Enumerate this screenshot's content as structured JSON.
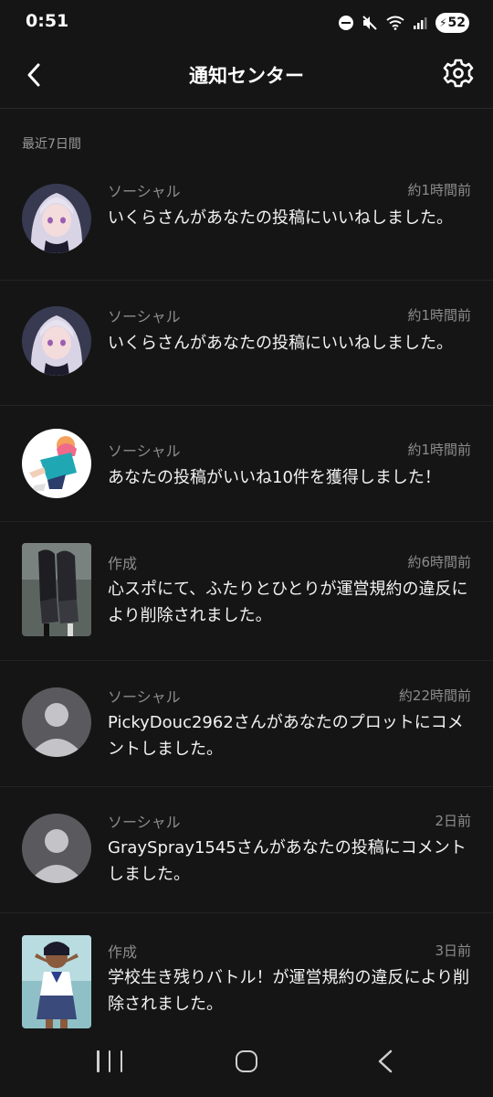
{
  "status_bar": {
    "time": "0:51",
    "battery": "52"
  },
  "header": {
    "title": "通知センター"
  },
  "section": {
    "label": "最近7日間"
  },
  "notifications": [
    {
      "category": "ソーシャル",
      "time": "約1時間前",
      "message": "いくらさんがあなたの投稿にいいねしました。",
      "avatar": "anime-girl-silver-hair"
    },
    {
      "category": "ソーシャル",
      "time": "約1時間前",
      "message": "いくらさんがあなたの投稿にいいねしました。",
      "avatar": "anime-girl-silver-hair"
    },
    {
      "category": "ソーシャル",
      "time": "約1時間前",
      "message": "あなたの投稿がいいね10件を獲得しました！",
      "avatar": "anime-character-teal-jacket"
    },
    {
      "category": "作成",
      "time": "約6時間前",
      "message": "心スポにて、ふたりとひとりが運営規約の違反により削除されました。",
      "avatar": "thumbnail-two-girls-rain"
    },
    {
      "category": "ソーシャル",
      "time": "約22時間前",
      "message": "PickyDouc2962さんがあなたのプロットにコメントしました。",
      "avatar": "default-user"
    },
    {
      "category": "ソーシャル",
      "time": "2日前",
      "message": "GraySpray1545さんがあなたの投稿にコメントしました。",
      "avatar": "default-user"
    },
    {
      "category": "作成",
      "time": "3日前",
      "message": "学校生き残りバトル！が運営規約の違反により削除されました。",
      "avatar": "thumbnail-schoolgirl"
    }
  ],
  "colors": {
    "background": "#151515",
    "text_primary": "#f2f2f2",
    "text_secondary": "#8c8c8c",
    "divider": "#232323"
  }
}
